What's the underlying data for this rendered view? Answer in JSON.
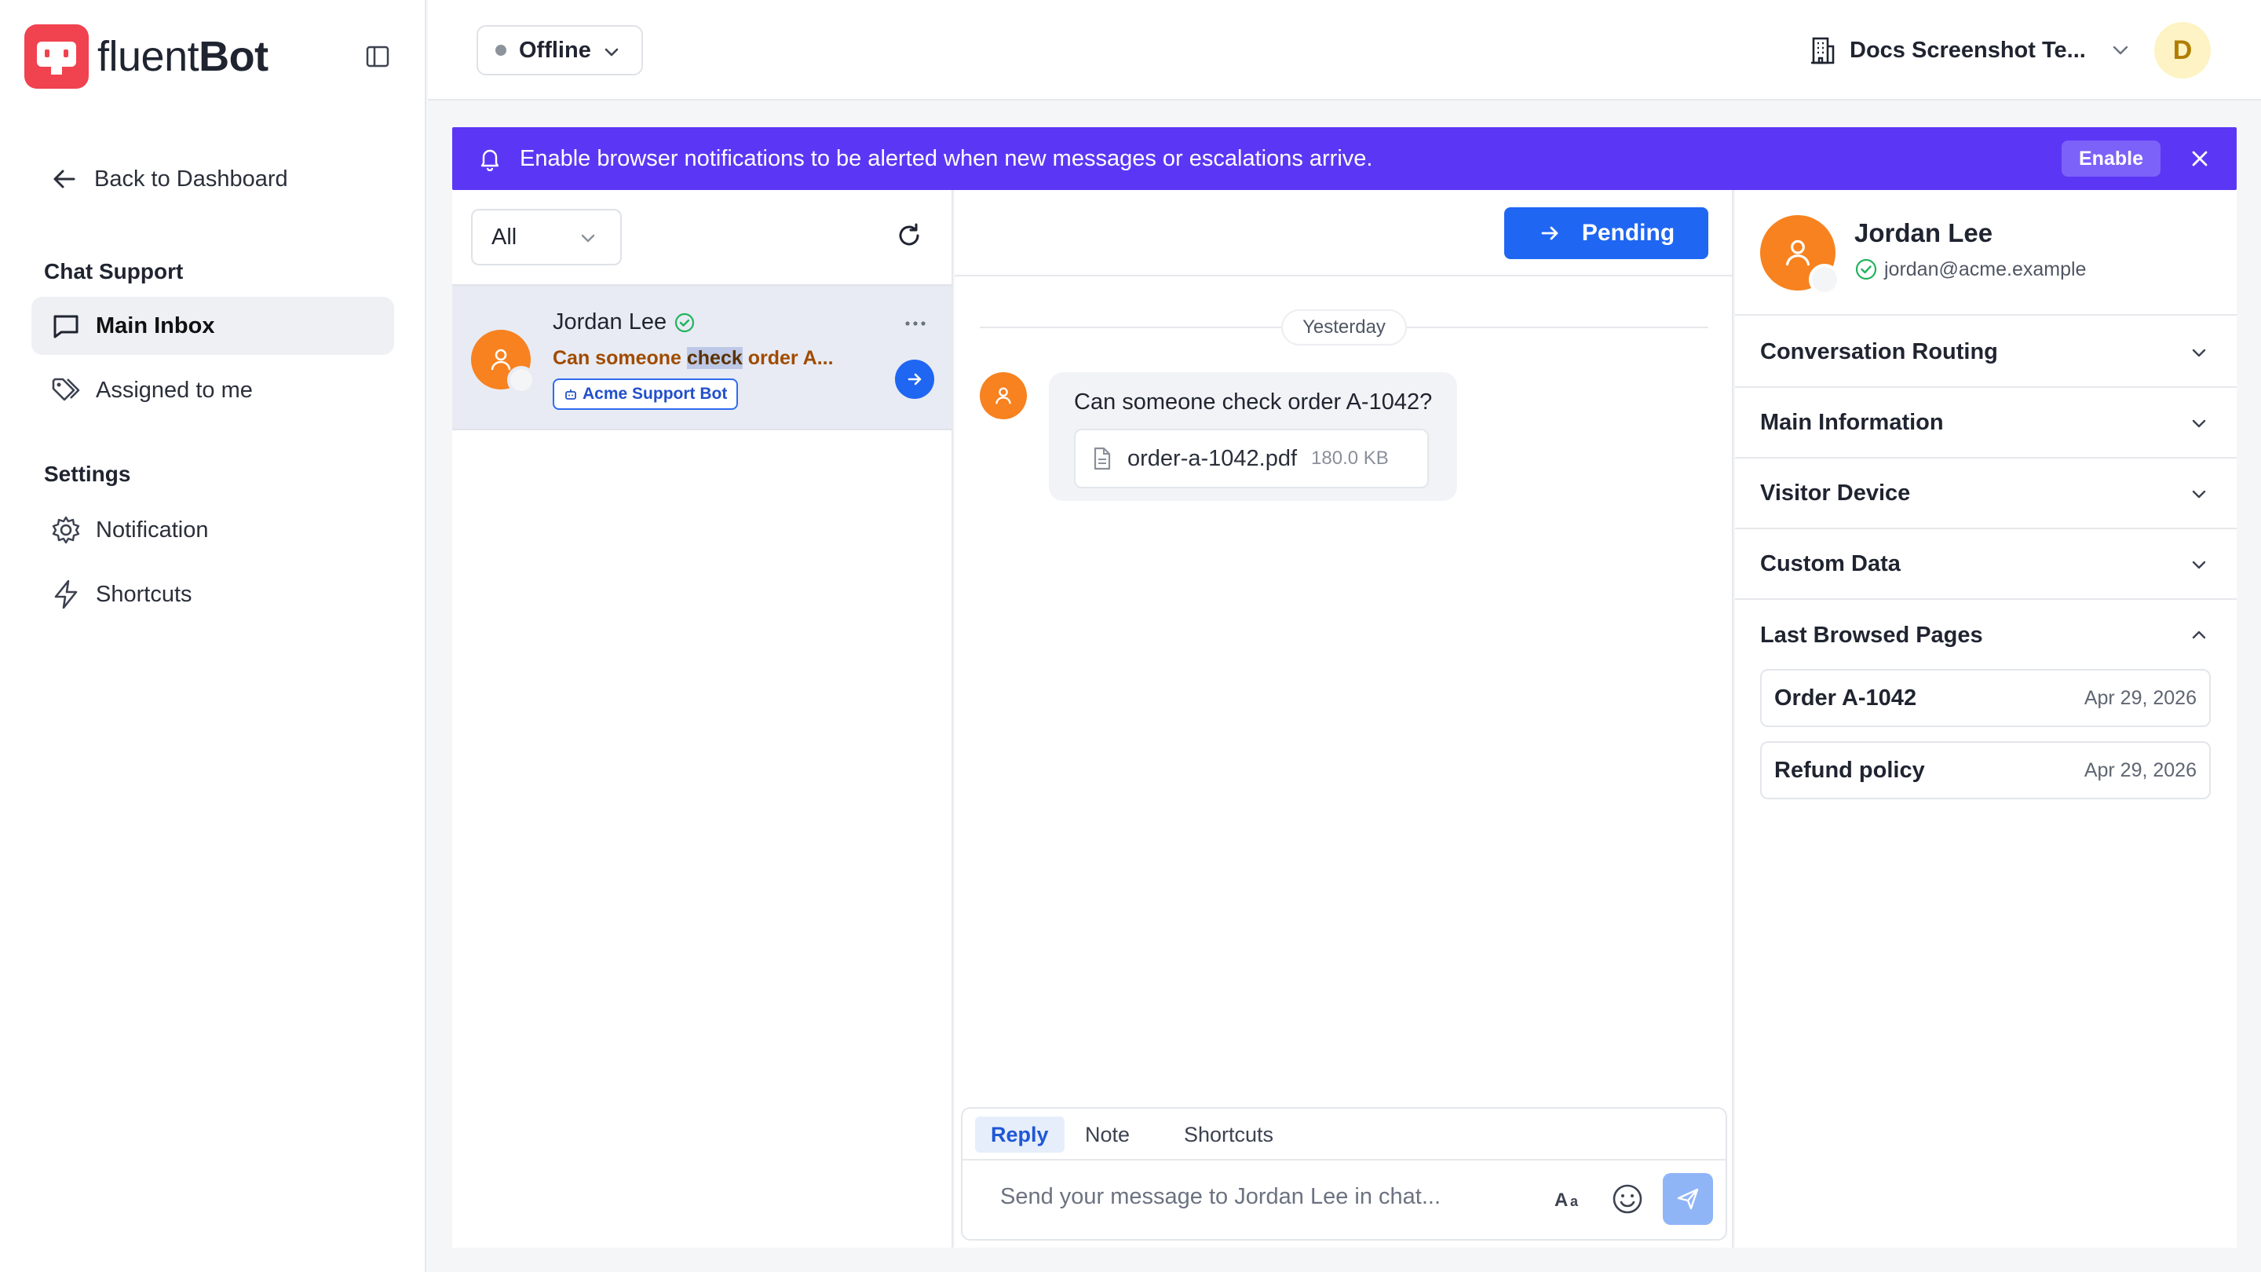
{
  "app": {
    "brand_prefix": "fluent",
    "brand_suffix": "Bot"
  },
  "sidebar": {
    "back_label": "Back to Dashboard",
    "chat_support_title": "Chat Support",
    "chat_items": [
      {
        "label": "Main Inbox",
        "icon": "message-square-icon",
        "active": true
      },
      {
        "label": "Assigned to me",
        "icon": "tags-icon",
        "active": false
      }
    ],
    "settings_title": "Settings",
    "settings_items": [
      {
        "label": "Notification",
        "icon": "gear-icon"
      },
      {
        "label": "Shortcuts",
        "icon": "lightning-icon"
      }
    ]
  },
  "topbar": {
    "status": "Offline",
    "workspace": "Docs Screenshot Te...",
    "user_initial": "D"
  },
  "banner": {
    "text": "Enable browser notifications to be alerted when new messages or escalations arrive.",
    "enable_label": "Enable",
    "color": "#5b37f5"
  },
  "conversations": {
    "filter": "All",
    "items": [
      {
        "name": "Jordan Lee",
        "preview_before": "Can someone ",
        "preview_highlight": "check",
        "preview_after": " order A...",
        "bot_tag": "Acme Support Bot"
      }
    ]
  },
  "chat": {
    "action_label": "Pending",
    "day_label": "Yesterday",
    "message": {
      "text": "Can someone check order A-1042?",
      "attachment_name": "order-a-1042.pdf",
      "attachment_size": "180.0 KB"
    },
    "composer": {
      "tabs": [
        "Reply",
        "Note",
        "Shortcuts"
      ],
      "active_tab": "Reply",
      "placeholder": "Send your message to Jordan Lee in chat..."
    }
  },
  "details": {
    "name": "Jordan Lee",
    "email": "jordan@acme.example",
    "sections": [
      {
        "label": "Conversation Routing",
        "open": false
      },
      {
        "label": "Main Information",
        "open": false
      },
      {
        "label": "Visitor Device",
        "open": false
      },
      {
        "label": "Custom Data",
        "open": false
      },
      {
        "label": "Last Browsed Pages",
        "open": true
      }
    ],
    "browsed_pages": [
      {
        "title": "Order A-1042",
        "date": "Apr 29, 2026"
      },
      {
        "title": "Refund policy",
        "date": "Apr 29, 2026"
      }
    ]
  },
  "colors": {
    "primary": "#1f66f2",
    "brand_red": "#f0424f",
    "avatar_orange": "#f7821f"
  }
}
